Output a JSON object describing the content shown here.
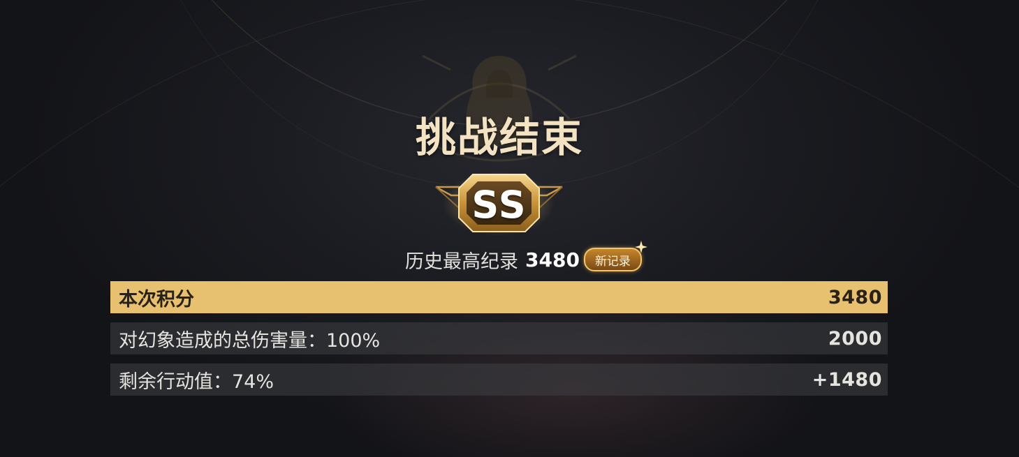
{
  "title": "挑战结束",
  "rank": "SS",
  "record": {
    "label": "历史最高纪录",
    "value": "3480",
    "new_badge": "新记录"
  },
  "score_rows": [
    {
      "label": "本次积分",
      "value": "3480",
      "highlight": true
    },
    {
      "label": "对幻象造成的总伤害量：100%",
      "value": "2000",
      "highlight": false
    },
    {
      "label": "剩余行动值：74%",
      "value": "+1480",
      "highlight": false
    }
  ],
  "colors": {
    "title": "#f3e3c3",
    "gold_bar": "#e8c170",
    "badge_gold": "#d9a44a"
  },
  "icons": {
    "emblem": "faded-boss-emblem-icon",
    "rank_badge": "rank-badge-icon",
    "sparkle": "sparkle-icon"
  }
}
